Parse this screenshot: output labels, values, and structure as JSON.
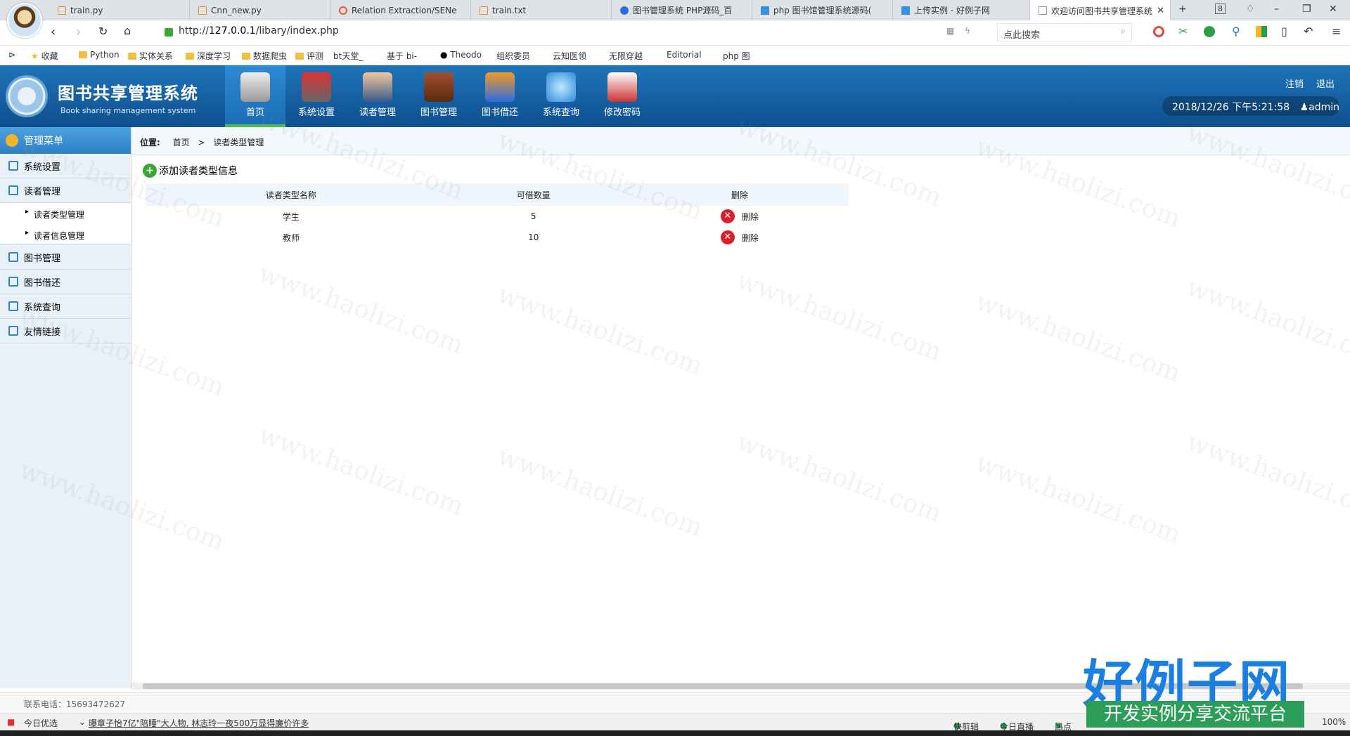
{
  "browser": {
    "tabs": [
      {
        "label": "train.py"
      },
      {
        "label": "Cnn_new.py"
      },
      {
        "label": "Relation Extraction/SENe"
      },
      {
        "label": "train.txt"
      },
      {
        "label": "图书管理系统 PHP源码_百"
      },
      {
        "label": "php 图书馆管理系统源码("
      },
      {
        "label": "上传实例 - 好例子网"
      },
      {
        "label": "欢迎访问图书共享管理系统"
      }
    ],
    "tab_count": "8",
    "url_prefix": "http://",
    "url_host": "127.0.0.1",
    "url_path": "/libary/index.php",
    "search_placeholder": "点此搜索",
    "bookmarks": [
      "收藏",
      "Python",
      "实体关系",
      "深度学习",
      "数据爬虫",
      "评测",
      "bt天堂_",
      "基于 bi-",
      "Theodo",
      "组织委员",
      "云知医领",
      "无限穿越",
      "Editorial",
      "php 图"
    ]
  },
  "app": {
    "title": "图书共享管理系统",
    "subtitle": "Book sharing management system",
    "nav": [
      "首页",
      "系统设置",
      "读者管理",
      "图书管理",
      "图书借还",
      "系统查询",
      "修改密码"
    ],
    "logout": "注销",
    "exit": "退出",
    "datetime": "2018/12/26 下午5:21:58",
    "user": "admin"
  },
  "sidebar": {
    "header": "管理菜单",
    "items": [
      {
        "label": "系统设置"
      },
      {
        "label": "读者管理"
      },
      {
        "label": "图书管理"
      },
      {
        "label": "图书借还"
      },
      {
        "label": "系统查询"
      },
      {
        "label": "友情链接"
      }
    ],
    "subitems": [
      "读者类型管理",
      "读者信息管理"
    ]
  },
  "main": {
    "crumb_label": "位置:",
    "crumb_home": "首页",
    "crumb_sep": ">",
    "crumb_current": "读者类型管理",
    "add_label": "添加读者类型信息",
    "columns": [
      "读者类型名称",
      "可借数量",
      "删除"
    ],
    "rows": [
      {
        "name": "学生",
        "count": "5",
        "action": "删除"
      },
      {
        "name": "教师",
        "count": "10",
        "action": "删除"
      }
    ]
  },
  "footer": {
    "phone": "联系电话：15693472627"
  },
  "statusbar": {
    "left": "今日优选",
    "news": "曝章子怡7亿\"陪睡\"大人物, 林志玲一夜500万显得廉价许多",
    "items": [
      "快剪辑",
      "今日直播",
      "热点"
    ],
    "zoom": "100%"
  },
  "watermark": {
    "text": "www.haolizi.com",
    "brand": "好例子网",
    "brand_sub": "开发实例分享交流平台"
  },
  "colors": {
    "header": "#1f74b9",
    "active_nav_underline": "#4cc04c",
    "delete_icon": "#d8202a",
    "add_icon": "#3aa635"
  }
}
